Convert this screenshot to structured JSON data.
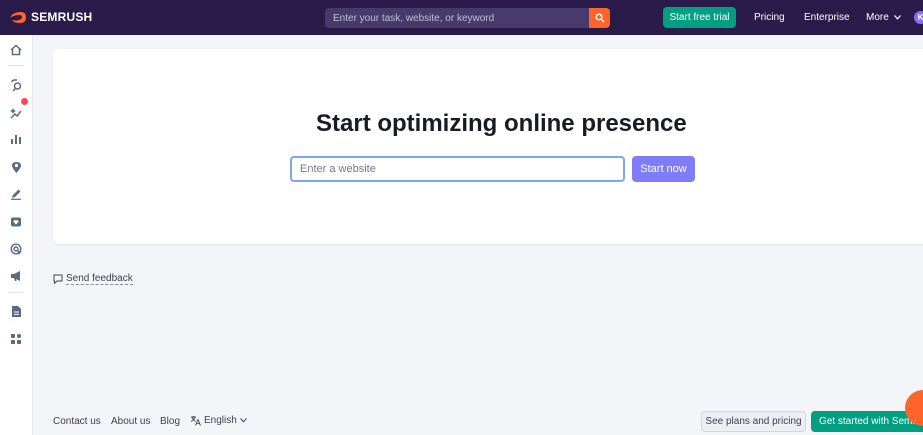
{
  "header": {
    "logo_text": "SEMRUSH",
    "search_placeholder": "Enter your task, website, or keyword",
    "trial_label": "Start free trial",
    "pricing_label": "Pricing",
    "enterprise_label": "Enterprise",
    "more_label": "More",
    "avatar_initial": "K"
  },
  "main": {
    "title": "Start optimizing online presence",
    "input_placeholder": "Enter a website",
    "start_label": "Start now"
  },
  "feedback": {
    "label": "Send feedback"
  },
  "footer": {
    "contact_label": "Contact us",
    "about_label": "About us",
    "blog_label": "Blog",
    "language_label": "English",
    "plans_label": "See plans and pricing",
    "get_started_label": "Get started with Semrush"
  },
  "sidebar": {
    "icons": [
      "home-icon",
      "seo-icon",
      "ai-sparkle-icon",
      "bar-chart-icon",
      "location-pin-icon",
      "pen-icon",
      "heart-shield-icon",
      "target-icon",
      "megaphone-icon",
      "document-icon",
      "apps-grid-icon"
    ]
  },
  "colors": {
    "topbar": "#2b1b4b",
    "accent_orange": "#ff642d",
    "brand_green": "#009f81",
    "primary_purple": "#7f7cf7"
  }
}
